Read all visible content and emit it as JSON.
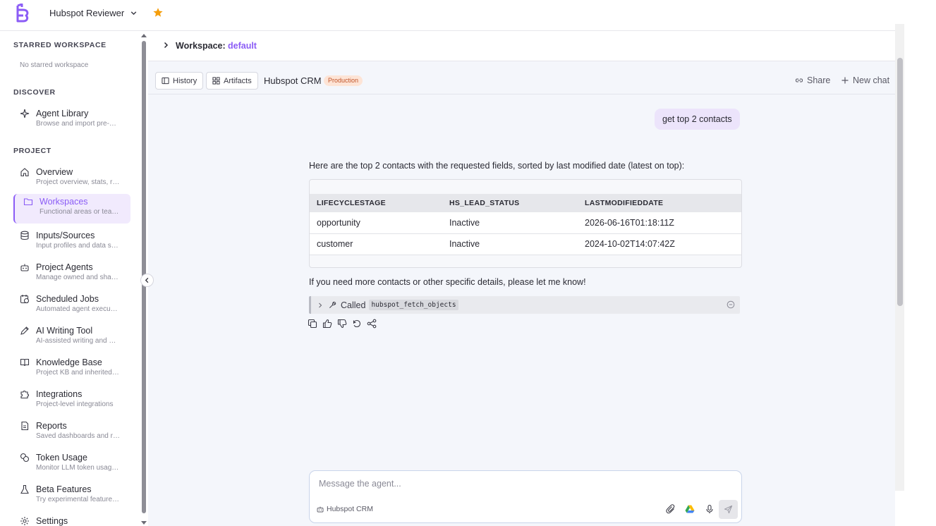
{
  "topbar": {
    "project_name": "Hubspot Reviewer"
  },
  "sidebar": {
    "starred_title": "STARRED WORKSPACE",
    "starred_empty": "No starred workspace",
    "discover_title": "DISCOVER",
    "project_title": "PROJECT",
    "discover_items": [
      {
        "label": "Agent Library",
        "desc": "Browse and import pre-…"
      }
    ],
    "items": [
      {
        "label": "Overview",
        "desc": "Project overview, stats, r…"
      },
      {
        "label": "Workspaces",
        "desc": "Functional areas or tea…"
      },
      {
        "label": "Inputs/Sources",
        "desc": "Input profiles and data s…"
      },
      {
        "label": "Project Agents",
        "desc": "Manage owned and sha…"
      },
      {
        "label": "Scheduled Jobs",
        "desc": "Automated agent execu…"
      },
      {
        "label": "AI Writing Tool",
        "desc": "AI-assisted writing and …"
      },
      {
        "label": "Knowledge Base",
        "desc": "Project KB and inherited…"
      },
      {
        "label": "Integrations",
        "desc": "Project-level integrations"
      },
      {
        "label": "Reports",
        "desc": "Saved dashboards and r…"
      },
      {
        "label": "Token Usage",
        "desc": "Monitor LLM token usag…"
      },
      {
        "label": "Beta Features",
        "desc": "Try experimental feature…"
      },
      {
        "label": "Settings",
        "desc": ""
      }
    ],
    "active_index": 1
  },
  "workspace": {
    "label": "Workspace:",
    "value": "default"
  },
  "chat_header": {
    "history_label": "History",
    "artifacts_label": "Artifacts",
    "agent_name": "Hubspot CRM",
    "env_badge": "Production",
    "share_label": "Share",
    "new_chat_label": "New chat"
  },
  "conversation": {
    "user_message": "get top 2 contacts",
    "ai_intro": "Here are the top 2 contacts with the requested fields, sorted by last modified date (latest on top):",
    "table": {
      "headers": [
        "LIFECYCLESTAGE",
        "HS_LEAD_STATUS",
        "LASTMODIFIEDDATE"
      ],
      "rows": [
        [
          "opportunity",
          "Inactive",
          "2026-06-16T01:18:11Z"
        ],
        [
          "customer",
          "Inactive",
          "2024-10-02T14:07:42Z"
        ]
      ]
    },
    "ai_outro": "If you need more contacts or other specific details, please let me know!",
    "tool_call": {
      "prefix": "Called",
      "name": "hubspot_fetch_objects"
    }
  },
  "composer": {
    "placeholder": "Message the agent...",
    "agent_label": "Hubspot CRM"
  },
  "colors": {
    "accent": "#8b5cf6",
    "star": "#f59e0b",
    "badge_bg": "#fde4d6",
    "badge_text": "#c2552a"
  }
}
